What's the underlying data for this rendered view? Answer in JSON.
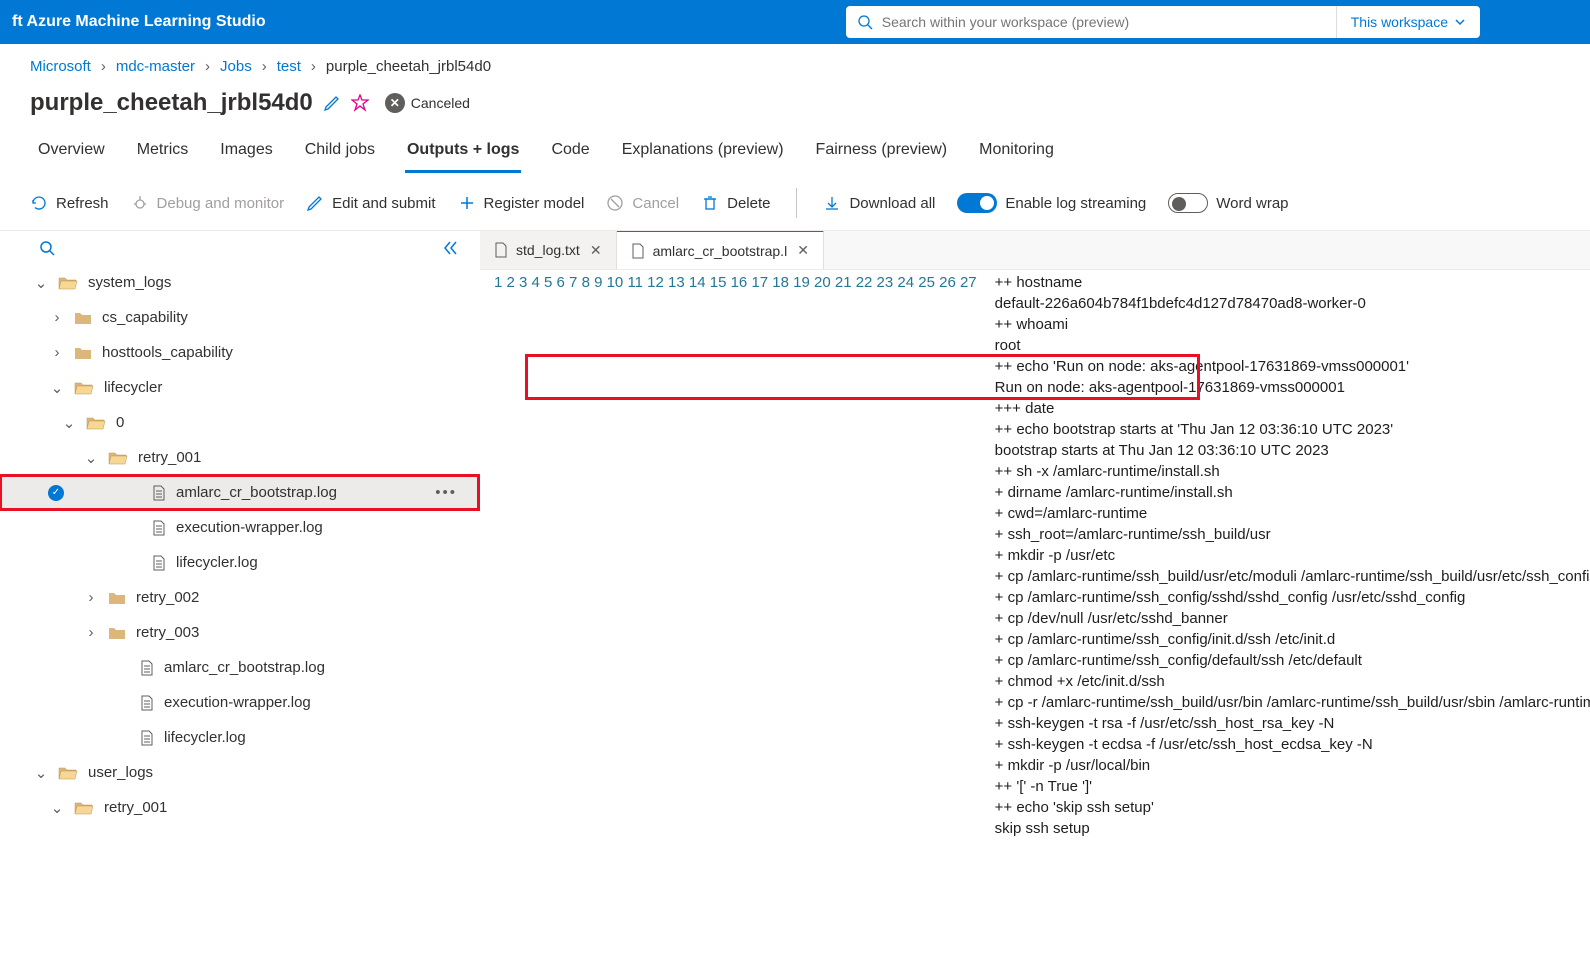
{
  "brand": "ft Azure Machine Learning Studio",
  "search": {
    "placeholder": "Search within your workspace (preview)",
    "scope_label": "This workspace"
  },
  "breadcrumb": [
    "Microsoft",
    "mdc-master",
    "Jobs",
    "test",
    "purple_cheetah_jrbl54d0"
  ],
  "job": {
    "title": "purple_cheetah_jrbl54d0",
    "status": "Canceled"
  },
  "tabs": [
    "Overview",
    "Metrics",
    "Images",
    "Child jobs",
    "Outputs + logs",
    "Code",
    "Explanations (preview)",
    "Fairness (preview)",
    "Monitoring"
  ],
  "active_tab": "Outputs + logs",
  "toolbar": {
    "refresh": "Refresh",
    "debug": "Debug and monitor",
    "edit": "Edit and submit",
    "register": "Register model",
    "cancel": "Cancel",
    "delete": "Delete",
    "download": "Download all",
    "log_stream": "Enable log streaming",
    "wordwrap": "Word wrap"
  },
  "tree": {
    "system_logs": {
      "label": "system_logs",
      "children": {
        "cs_capability": "cs_capability",
        "hosttools_capability": "hosttools_capability",
        "lifecycler": {
          "label": "lifecycler",
          "zero": {
            "label": "0",
            "retry_001": {
              "label": "retry_001",
              "files": [
                "amlarc_cr_bootstrap.log",
                "execution-wrapper.log",
                "lifecycler.log"
              ]
            },
            "retry_002": "retry_002",
            "retry_003": "retry_003",
            "files": [
              "amlarc_cr_bootstrap.log",
              "execution-wrapper.log",
              "lifecycler.log"
            ]
          }
        }
      }
    },
    "user_logs": {
      "label": "user_logs",
      "retry_001": "retry_001"
    }
  },
  "editor_tabs": [
    {
      "name": "std_log.txt",
      "active": false
    },
    {
      "name": "amlarc_cr_bootstrap.l",
      "active": true
    }
  ],
  "code_lines": [
    "++ hostname",
    "default-226a604b784f1bdefc4d127d78470ad8-worker-0",
    "++ whoami",
    "root",
    "++ echo 'Run on node: aks-agentpool-17631869-vmss000001'",
    "Run on node: aks-agentpool-17631869-vmss000001",
    "+++ date",
    "++ echo bootstrap starts at 'Thu Jan 12 03:36:10 UTC 2023'",
    "bootstrap starts at Thu Jan 12 03:36:10 UTC 2023",
    "++ sh -x /amlarc-runtime/install.sh",
    "+ dirname /amlarc-runtime/install.sh",
    "+ cwd=/amlarc-runtime",
    "+ ssh_root=/amlarc-runtime/ssh_build/usr",
    "+ mkdir -p /usr/etc",
    "+ cp /amlarc-runtime/ssh_build/usr/etc/moduli /amlarc-runtime/ssh_build/usr/etc/ssh_config /amlarc-run",
    "+ cp /amlarc-runtime/ssh_config/sshd/sshd_config /usr/etc/sshd_config",
    "+ cp /dev/null /usr/etc/sshd_banner",
    "+ cp /amlarc-runtime/ssh_config/init.d/ssh /etc/init.d",
    "+ cp /amlarc-runtime/ssh_config/default/ssh /etc/default",
    "+ chmod +x /etc/init.d/ssh",
    "+ cp -r /amlarc-runtime/ssh_build/usr/bin /amlarc-runtime/ssh_build/usr/sbin /amlarc-runtime/ssh_build",
    "+ ssh-keygen -t rsa -f /usr/etc/ssh_host_rsa_key -N",
    "+ ssh-keygen -t ecdsa -f /usr/etc/ssh_host_ecdsa_key -N",
    "+ mkdir -p /usr/local/bin",
    "++ '[' -n True ']'",
    "++ echo 'skip ssh setup'",
    "skip ssh setup"
  ],
  "highlight_lines": [
    5,
    6
  ]
}
